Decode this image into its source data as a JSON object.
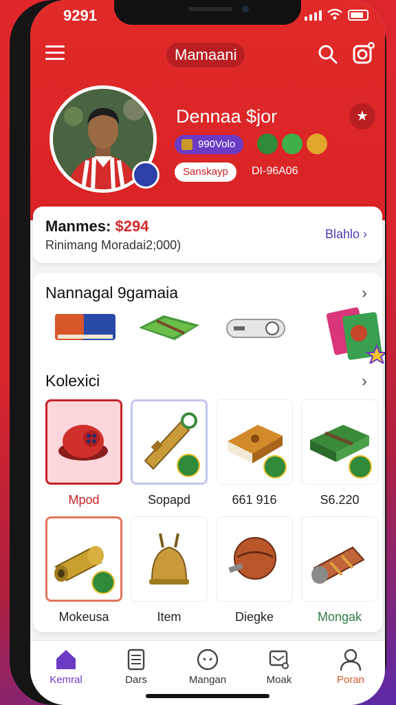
{
  "status_bar": {
    "time": "9291"
  },
  "header": {
    "title": "Mamaani"
  },
  "profile": {
    "name": "Dennaa $jor",
    "id_pill": "990Volo",
    "status_pill": "Sanskayp",
    "status_code": "DI-96A06"
  },
  "balance": {
    "label": "Manmes:",
    "amount": "$294",
    "subtitle": "Rinimang Moradai2;000)",
    "link": "Blahlo"
  },
  "promo": {
    "title": "Nannagal 9gamaia"
  },
  "collection": {
    "title": "Kolexici",
    "items": [
      {
        "label": "Mpod"
      },
      {
        "label": "Sopapd"
      },
      {
        "label": "661 916"
      },
      {
        "label": "S6.220"
      },
      {
        "label": "Mokeusa"
      },
      {
        "label": "Item"
      },
      {
        "label": "Diegke"
      },
      {
        "label": "Mongak"
      }
    ]
  },
  "nav": {
    "items": [
      {
        "label": "Kemral"
      },
      {
        "label": "Dars"
      },
      {
        "label": "Mangan"
      },
      {
        "label": "Moak"
      },
      {
        "label": "Poran"
      }
    ]
  },
  "colors": {
    "hero_red": "#e12a29",
    "accent_purple": "#6c3bc4",
    "price_red": "#d12a2a",
    "link_blue": "#4c3bb5"
  }
}
